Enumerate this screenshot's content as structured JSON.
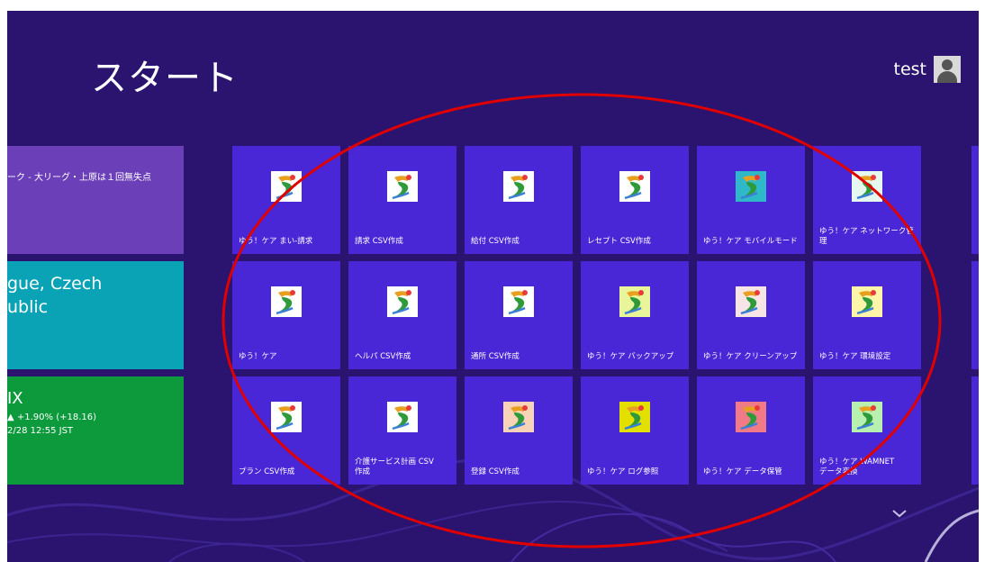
{
  "header": {
    "title": "スタート",
    "user_name": "test"
  },
  "live_tiles": {
    "news": {
      "text": "ーク - 大リーグ・上原は１回無失点"
    },
    "weather": {
      "line1": "gue, Czech",
      "line2": "ublic"
    },
    "finance": {
      "name": "IX",
      "change": "▲ +1.90% (+18.16)",
      "time": "2/28 12:55 JST"
    }
  },
  "tiles": [
    {
      "label": "ゆう！ケア  まい-請求",
      "icon_bg": "#ffffff",
      "icon": "care-figure-icon"
    },
    {
      "label": "請求 CSV作成",
      "icon_bg": "#ffffff",
      "icon": "care-figure-icon"
    },
    {
      "label": "給付 CSV作成",
      "icon_bg": "#ffffff",
      "icon": "care-figure-icon"
    },
    {
      "label": "レセプト CSV作成",
      "icon_bg": "#ffffff",
      "icon": "care-figure-icon"
    },
    {
      "label": "ゆう！ケア  モバイルモード",
      "icon_bg": "#2fb8c8",
      "icon": "care-figure-icon"
    },
    {
      "label": "ゆう！ケア  ネットワーク管理",
      "icon_bg": "#e6f7ef",
      "icon": "care-figure-icon"
    },
    {
      "label": "ゆう！ケア",
      "icon_bg": "#ffffff",
      "icon": "care-figure-icon"
    },
    {
      "label": "ヘルパ CSV作成",
      "icon_bg": "#ffffff",
      "icon": "care-figure-icon"
    },
    {
      "label": "通所 CSV作成",
      "icon_bg": "#ffffff",
      "icon": "care-figure-icon"
    },
    {
      "label": "ゆう！ケア  バックアップ",
      "icon_bg": "#e8f59a",
      "icon": "care-figure-icon"
    },
    {
      "label": "ゆう！ケア  クリーンアップ",
      "icon_bg": "#f7e4e4",
      "icon": "care-figure-icon"
    },
    {
      "label": "ゆう！ケア  環境設定",
      "icon_bg": "#fff5a8",
      "icon": "care-figure-icon"
    },
    {
      "label": "プラン CSV作成",
      "icon_bg": "#ffffff",
      "icon": "care-figure-icon"
    },
    {
      "label": "介護サービス計画 CSV\n作成",
      "icon_bg": "#ffffff",
      "icon": "care-figure-icon"
    },
    {
      "label": "登録 CSV作成",
      "icon_bg": "#f9d3b8",
      "icon": "care-figure-icon"
    },
    {
      "label": "ゆう！ケア  ログ参照",
      "icon_bg": "#e3e000",
      "icon": "care-figure-icon"
    },
    {
      "label": "ゆう！ケア  データ保管",
      "icon_bg": "#f07a86",
      "icon": "care-figure-icon"
    },
    {
      "label": "ゆう！ケア  WAMNET\nデータ変換",
      "icon_bg": "#b8f0b0",
      "icon": "care-figure-icon"
    }
  ],
  "colors": {
    "background": "#2a1470",
    "tile": "#4a27d6",
    "news_tile": "#6b3fb7",
    "weather_tile": "#0aa3b6",
    "finance_tile": "#0c9a3c",
    "highlight": "#e00000"
  }
}
